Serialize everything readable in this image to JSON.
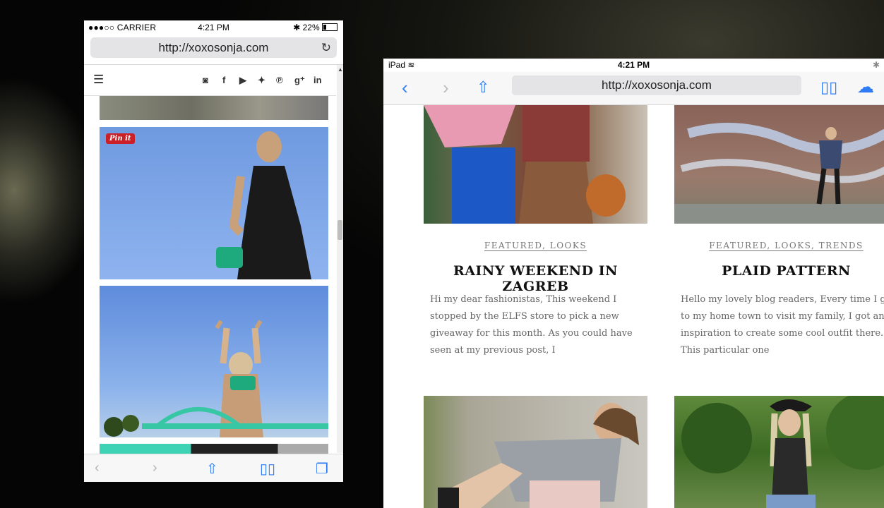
{
  "phone": {
    "status": {
      "signal": "●●●○○ CARRIER",
      "time": "4:21 PM",
      "battery": "22%"
    },
    "url": "http://xoxosonja.com",
    "menu_icon": "menu-icon",
    "social": [
      "instagram-icon",
      "facebook-icon",
      "youtube-icon",
      "twitter-icon",
      "pinterest-icon",
      "google-plus-icon",
      "linkedin-icon"
    ],
    "pin_label": "Pin it",
    "bottom": [
      "back-icon",
      "forward-icon",
      "share-icon",
      "bookmarks-icon",
      "tabs-icon"
    ]
  },
  "tablet": {
    "status": {
      "device": "iPad",
      "time": "4:21 PM"
    },
    "url": "http://xoxosonja.com",
    "posts": [
      {
        "categories": "FEATURED, LOOKS",
        "title": "RAINY WEEKEND IN ZAGREB",
        "excerpt": "Hi my dear fashionistas, This weekend I stopped by the ELFS store to pick a new giveaway for this month. As you could have seen at my previous post, I"
      },
      {
        "categories": "FEATURED, LOOKS, TRENDS",
        "title": "PLAID PATTERN",
        "excerpt": "Hello my lovely blog readers, Every time I go to my home town to visit my family, I got an inspiration to create some cool outfit there. This particular one"
      }
    ]
  },
  "colors": {
    "ios_blue": "#2d7cf6",
    "pinterest_red": "#cb2027"
  }
}
